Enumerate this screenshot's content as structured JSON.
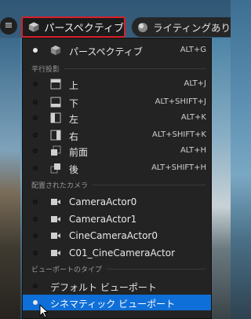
{
  "toolbar": {
    "menu_glyph": "≡",
    "perspective_label": "パースペクティブ",
    "lighting_label": "ライティングあり"
  },
  "menu": {
    "perspective": {
      "label": "パースペクティブ",
      "shortcut": "ALT+G",
      "icon": "cube-icon"
    },
    "sections": {
      "ortho": "平行投影",
      "cameras": "配置されたカメラ",
      "viewport_type": "ビューポートのタイプ"
    },
    "ortho_items": [
      {
        "label": "上",
        "shortcut": "ALT+J",
        "icon": "view-top-icon"
      },
      {
        "label": "下",
        "shortcut": "ALT+SHIFT+J",
        "icon": "view-bottom-icon"
      },
      {
        "label": "左",
        "shortcut": "ALT+K",
        "icon": "view-left-icon"
      },
      {
        "label": "右",
        "shortcut": "ALT+SHIFT+K",
        "icon": "view-right-icon"
      },
      {
        "label": "前面",
        "shortcut": "ALT+H",
        "icon": "view-front-icon"
      },
      {
        "label": "後",
        "shortcut": "ALT+SHIFT+H",
        "icon": "view-back-icon"
      }
    ],
    "cameras": [
      {
        "label": "CameraActor0",
        "icon": "camera-icon"
      },
      {
        "label": "CameraActor1",
        "icon": "camera-icon"
      },
      {
        "label": "CineCameraActor0",
        "icon": "camera-icon"
      },
      {
        "label": "C01_CineCameraActor",
        "icon": "camera-icon"
      }
    ],
    "viewport_types": [
      {
        "label": "デフォルト ビューポート"
      },
      {
        "label": "シネマティック ビューポート",
        "selected": true
      }
    ]
  },
  "colors": {
    "accent_selected": "#0f6fd8",
    "highlight_border": "#d8202a",
    "menu_bg": "#232323"
  }
}
